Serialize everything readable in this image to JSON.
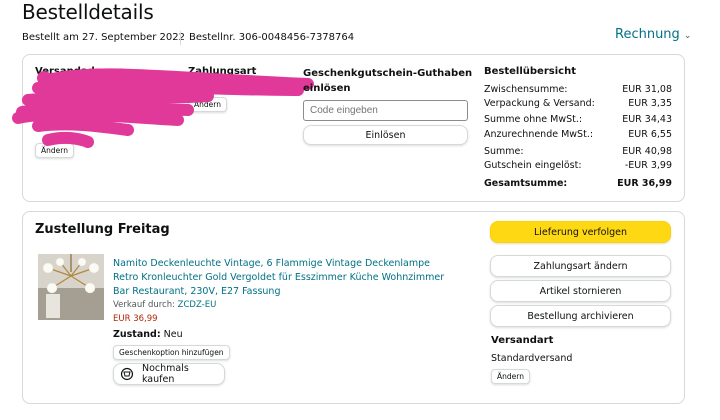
{
  "page": {
    "title": "Bestelldetails",
    "order_date": "Bestellt am 27. September 2022",
    "order_number": "Bestellnr. 306-0048456-7378764",
    "invoice_label": "Rechnung"
  },
  "summary_box": {
    "shipping_address_label": "Versandadresse",
    "address_edit": "Ändern",
    "payment_label": "Zahlungsart",
    "payment_edit": "Ändern",
    "giftcard_label": "Geschenkgutschein-Guthaben einlösen",
    "giftcard_placeholder": "Code eingeben",
    "giftcard_redeem": "Einlösen",
    "overview_label": "Bestellübersicht",
    "rows": [
      {
        "label": "Zwischensumme:",
        "value": "EUR 31,08"
      },
      {
        "label": "Verpackung & Versand:",
        "value": "EUR 3,35"
      },
      {
        "label": "Summe ohne MwSt.:",
        "value": "EUR 34,43"
      },
      {
        "label": "Anzurechnende MwSt.:",
        "value": "EUR 6,55"
      },
      {
        "label": "Summe:",
        "value": "EUR 40,98"
      },
      {
        "label": "Gutschein eingelöst:",
        "value": "-EUR 3,99"
      },
      {
        "label": "Gesamtsumme:",
        "value": "EUR 36,99"
      }
    ]
  },
  "delivery": {
    "heading": "Zustellung Freitag",
    "product_title": "Namito Deckenleuchte Vintage, 6 Flammige Vintage Deckenlampe Retro Kronleuchter Gold Vergoldet für Esszimmer Küche Wohnzimmer Bar Restaurant, 230V, E27 Fassung",
    "seller_label": "Verkauf durch:",
    "seller_name": "ZCDZ-EU",
    "price": "EUR 36,99",
    "condition_label": "Zustand:",
    "condition_value": "Neu",
    "gift_option": "Geschenkoption hinzufügen",
    "buy_again": "Nochmals kaufen",
    "actions": {
      "track": "Lieferung verfolgen",
      "change_payment": "Zahlungsart ändern",
      "cancel": "Artikel stornieren",
      "archive": "Bestellung archivieren"
    },
    "shipping_type_label": "Versandart",
    "shipping_type_value": "Standardversand",
    "shipping_edit": "Ändern"
  },
  "colors": {
    "link": "#007185",
    "price": "#b12704",
    "primary_button": "#ffd814",
    "redaction": "#e0399a"
  }
}
